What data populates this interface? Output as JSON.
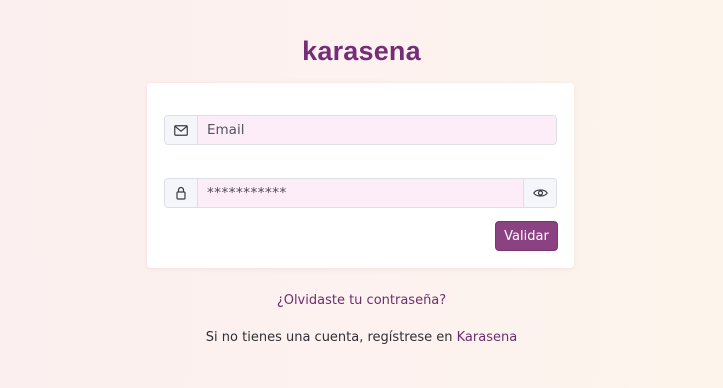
{
  "brand": {
    "title": "karasena"
  },
  "login": {
    "email_placeholder": "Email",
    "password_masked": "***********",
    "submit_label": "Validar"
  },
  "links": {
    "forgot_password": "¿Olvidaste tu contraseña?",
    "register_prefix": "Si no tienes una cuenta, regístrese en",
    "register_link": "Karasena"
  },
  "icons": {
    "email": "envelope-icon",
    "password": "lock-icon",
    "toggle": "eye-icon"
  },
  "colors": {
    "brand": "#762d77",
    "button": "#8b4283",
    "input_background": "#fcedf8",
    "link": "#6c2f6e"
  }
}
